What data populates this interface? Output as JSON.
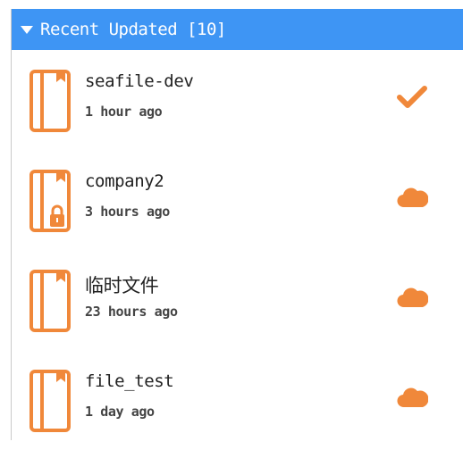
{
  "header": {
    "title": "Recent Updated [10]",
    "caret_icon": "caret-down-icon"
  },
  "colors": {
    "header_bg": "#3e95f4",
    "accent_orange": "#f0883a",
    "text_dark": "#222222",
    "text_muted": "#444444"
  },
  "repos": [
    {
      "name": "seafile-dev",
      "time": "1 hour ago",
      "icon": "library-icon",
      "locked": false,
      "status": "synced",
      "status_icon": "checkmark-icon"
    },
    {
      "name": "company2",
      "time": "3 hours ago",
      "icon": "library-icon",
      "locked": true,
      "status": "cloud",
      "status_icon": "cloud-icon"
    },
    {
      "name": "临时文件",
      "time": "23 hours ago",
      "icon": "library-icon",
      "locked": false,
      "status": "cloud",
      "status_icon": "cloud-icon"
    },
    {
      "name": "file_test",
      "time": "1 day ago",
      "icon": "library-icon",
      "locked": false,
      "status": "cloud",
      "status_icon": "cloud-icon"
    }
  ]
}
